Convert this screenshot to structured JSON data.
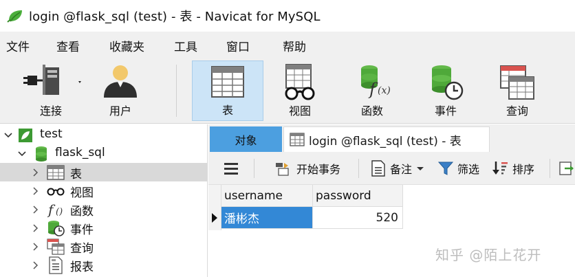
{
  "window": {
    "title": "login @flask_sql (test) - 表 - Navicat for MySQL",
    "logo_icon": "navicat-leaf-icon"
  },
  "menu": [
    "文件",
    "查看",
    "收藏夹",
    "工具",
    "窗口",
    "帮助"
  ],
  "toolbar": {
    "items": [
      {
        "label": "连接",
        "icon": "connection-plug-icon"
      },
      {
        "label": "用户",
        "icon": "user-icon"
      },
      {
        "label": "表",
        "icon": "table-icon",
        "active": true
      },
      {
        "label": "视图",
        "icon": "view-glasses-icon"
      },
      {
        "label": "函数",
        "icon": "function-icon"
      },
      {
        "label": "事件",
        "icon": "event-clock-icon"
      },
      {
        "label": "查询",
        "icon": "query-icon"
      }
    ]
  },
  "tree": {
    "connection": "test",
    "database": "flask_sql",
    "items": [
      {
        "label": "表",
        "icon": "table-icon",
        "selected": true
      },
      {
        "label": "视图",
        "icon": "view-glasses-icon"
      },
      {
        "label": "函数",
        "icon": "function-icon"
      },
      {
        "label": "事件",
        "icon": "event-clock-icon"
      },
      {
        "label": "查询",
        "icon": "query-icon"
      },
      {
        "label": "报表",
        "icon": "report-icon"
      }
    ]
  },
  "tabs": {
    "objects": "对象",
    "login": "login @flask_sql (test) - 表"
  },
  "subtoolbar": {
    "begin_transaction": "开始事务",
    "note": "备注",
    "filter": "筛选",
    "sort": "排序"
  },
  "grid": {
    "columns": [
      "username",
      "password"
    ],
    "rows": [
      [
        "潘彬杰",
        "520"
      ]
    ]
  },
  "watermark": "知乎 @陌上花开",
  "colors": {
    "accent_tab": "#4c9fe0",
    "selected_cell": "#3388d6",
    "active_tool": "#cce4f7"
  }
}
